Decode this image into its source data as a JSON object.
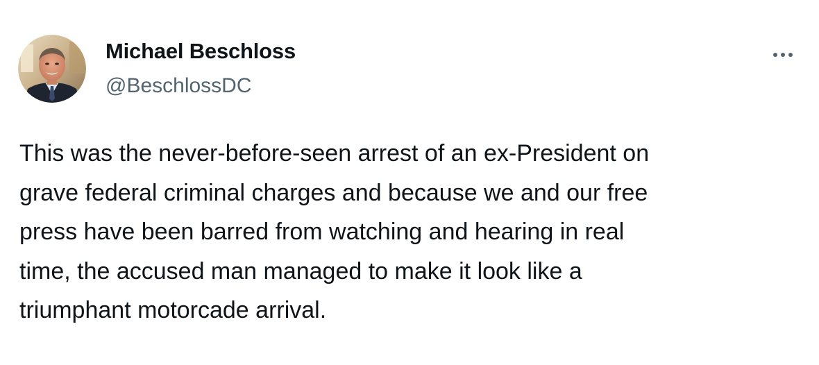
{
  "author": {
    "display_name": "Michael Beschloss",
    "handle": "@BeschlossDC",
    "avatar_alt": "avatar"
  },
  "more_icon": "more-horizontal-icon",
  "tweet": {
    "text": "This was the never-before-seen arrest of an ex-President on\ngrave federal criminal charges and because we and our free\npress have been barred from watching and hearing in real\ntime, the accused man managed to make it look like a\ntriumphant motorcade arrival."
  },
  "colors": {
    "text_primary": "#0f1419",
    "text_secondary": "#536471",
    "background": "#ffffff"
  }
}
